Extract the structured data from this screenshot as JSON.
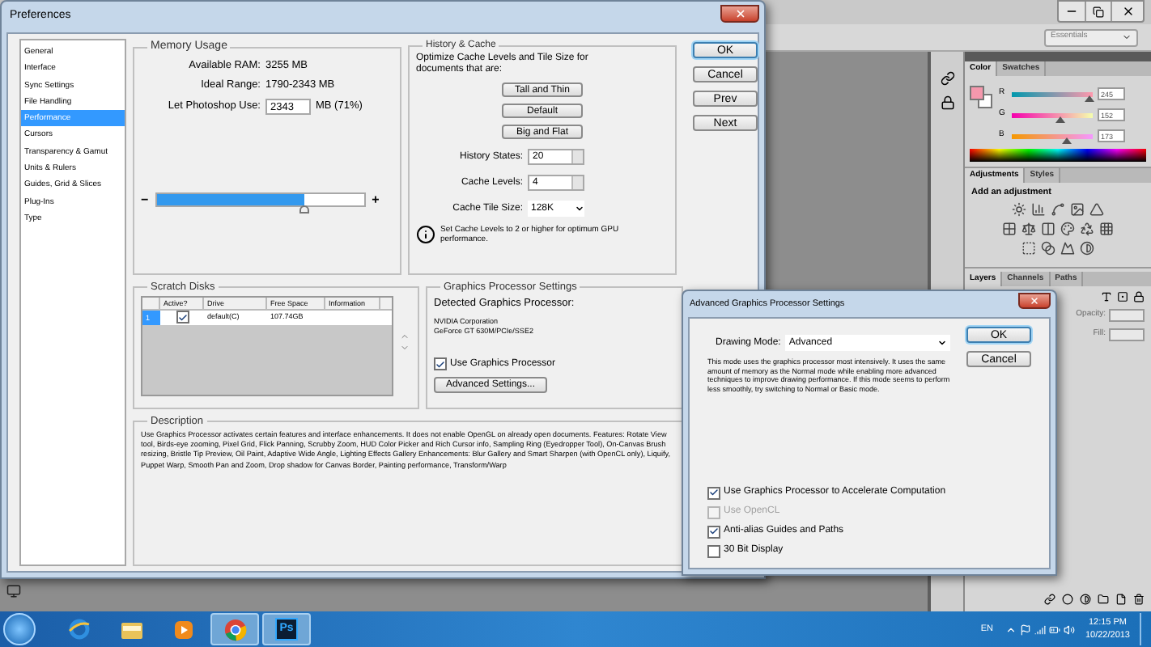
{
  "photoshop": {
    "workspace": "Essentials",
    "color_panel": {
      "tabs": [
        {
          "label": "Color",
          "selected": true
        },
        {
          "label": "Swatches",
          "selected": false
        }
      ],
      "channels": [
        {
          "name": "R",
          "value": "245",
          "level": 0.96
        },
        {
          "name": "G",
          "value": "152",
          "level": 0.6
        },
        {
          "name": "B",
          "value": "173",
          "level": 0.68
        }
      ]
    },
    "adjustments_panel": {
      "tabs": [
        {
          "label": "Adjustments",
          "selected": true
        },
        {
          "label": "Styles",
          "selected": false
        }
      ],
      "heading": "Add an adjustment"
    },
    "layers_panel": {
      "tabs": [
        {
          "label": "Layers",
          "selected": true
        },
        {
          "label": "Channels",
          "selected": false
        },
        {
          "label": "Paths",
          "selected": false
        }
      ],
      "opacity_label": "Opacity:",
      "fill_label": "Fill:"
    }
  },
  "preferences": {
    "title": "Preferences",
    "sidebar": [
      {
        "label": "General",
        "selected": false
      },
      {
        "label": "Interface",
        "selected": false
      },
      {
        "label": "Sync Settings",
        "selected": false
      },
      {
        "label": "File Handling",
        "selected": false
      },
      {
        "label": "Performance",
        "selected": true
      },
      {
        "label": "Cursors",
        "selected": false
      },
      {
        "label": "Transparency & Gamut",
        "selected": false
      },
      {
        "label": "Units & Rulers",
        "selected": false
      },
      {
        "label": "Guides, Grid & Slices",
        "selected": false
      },
      {
        "label": "Plug-Ins",
        "selected": false
      },
      {
        "label": "Type",
        "selected": false
      }
    ],
    "memory": {
      "title": "Memory Usage",
      "rows": [
        {
          "label": "Available RAM:",
          "value": "3255 MB"
        },
        {
          "label": "Ideal Range:",
          "value": "1790-2343 MB"
        }
      ],
      "use_label": "Let Photoshop Use:",
      "use_value": "2343",
      "use_unit": "MB (71%)",
      "minus": "−",
      "plus": "+",
      "level": 0.71
    },
    "history": {
      "title": "History & Cache",
      "intro": "Optimize Cache Levels and Tile Size for documents that are:",
      "presets": [
        "Tall and Thin",
        "Default",
        "Big and Flat"
      ],
      "fields": [
        {
          "label": "History States:",
          "value": "20",
          "kind": "spinner"
        },
        {
          "label": "Cache Levels:",
          "value": "4",
          "kind": "spinner"
        },
        {
          "label": "Cache Tile Size:",
          "value": "128K",
          "kind": "dropdown"
        }
      ],
      "note": "Set Cache Levels to 2 or higher for optimum GPU performance."
    },
    "buttons": [
      {
        "label": "OK",
        "default": true
      },
      {
        "label": "Cancel",
        "default": false
      },
      {
        "label": "Prev",
        "default": false
      },
      {
        "label": "Next",
        "default": false
      }
    ],
    "scratch": {
      "title": "Scratch Disks",
      "columns": [
        "Active?",
        "Drive",
        "Free Space",
        "Information"
      ],
      "rows": [
        {
          "index": "1",
          "selected": true,
          "active": true,
          "drive": "default(C)",
          "free_space": "107.74GB"
        }
      ]
    },
    "gpu": {
      "title": "Graphics Processor Settings",
      "detected_label": "Detected Graphics Processor:",
      "vendor": "NVIDIA Corporation",
      "model": "GeForce GT 630M/PCIe/SSE2",
      "use_gpu": {
        "label": "Use Graphics Processor",
        "checked": true
      },
      "advanced_button": "Advanced Settings..."
    },
    "description": {
      "title": "Description",
      "text": "Use Graphics Processor activates certain features and interface enhancements. It does not enable OpenGL on already open documents. Features: Rotate View tool, Birds-eye zooming, Pixel Grid, Flick Panning, Scrubby Zoom, HUD Color Picker and Rich Cursor info, Sampling Ring (Eyedropper Tool), On-Canvas Brush resizing, Bristle Tip Preview, Oil Paint, Adaptive Wide Angle, Lighting Effects Gallery Enhancements: Blur Gallery and Smart Sharpen (with OpenCL only), Liquify, Puppet Warp, Smooth Pan and Zoom, Drop shadow for Canvas Border, Painting performance, Transform/Warp"
    }
  },
  "advanced": {
    "title": "Advanced Graphics Processor Settings",
    "mode_label": "Drawing Mode:",
    "mode": "Advanced",
    "explanation": "This mode uses the graphics processor most intensively.  It uses the same amount of memory as the Normal mode while enabling more advanced techniques to improve drawing performance.  If this mode seems to perform less smoothly, try switching to Normal or Basic mode.",
    "buttons": [
      {
        "label": "OK",
        "default": true
      },
      {
        "label": "Cancel",
        "default": false
      }
    ],
    "options": [
      {
        "label": "Use Graphics Processor to Accelerate Computation",
        "checked": true,
        "disabled": false
      },
      {
        "label": "Use OpenCL",
        "checked": false,
        "disabled": true
      },
      {
        "label": "Anti-alias Guides and Paths",
        "checked": true,
        "disabled": false
      },
      {
        "label": "30 Bit Display",
        "checked": false,
        "disabled": false
      }
    ]
  },
  "taskbar": {
    "apps": [
      {
        "kind": "browser",
        "running": false
      },
      {
        "kind": "folder",
        "running": false
      },
      {
        "kind": "media",
        "running": false
      },
      {
        "kind": "chrome",
        "running": true
      },
      {
        "kind": "photoshop",
        "running": true,
        "label": "Ps"
      }
    ],
    "language": "EN",
    "time": "12:15 PM",
    "date": "10/22/2013"
  }
}
